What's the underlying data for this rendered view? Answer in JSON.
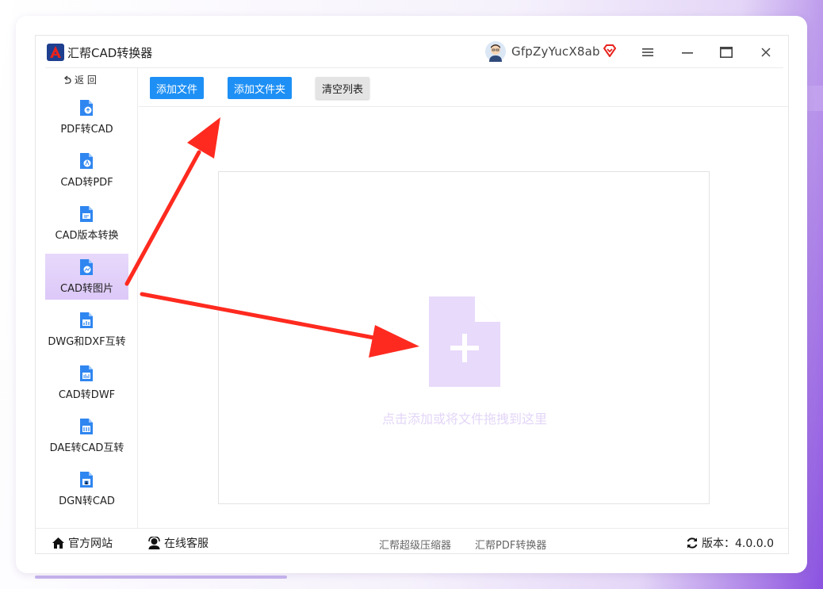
{
  "app": {
    "title": "汇帮CAD转换器",
    "username": "GfpZyYucX8ab"
  },
  "colors": {
    "accent": "#1e90f5",
    "active_nav": "#e2d1fa",
    "drop_icon": "#e8dafb",
    "arrow": "#ff2a1f"
  },
  "sidebar": {
    "back_label": "返 回",
    "items": [
      {
        "label": "PDF转CAD",
        "icon": "pdf-to-cad-icon"
      },
      {
        "label": "CAD转PDF",
        "icon": "cad-to-pdf-icon"
      },
      {
        "label": "CAD版本转换",
        "icon": "cad-version-icon"
      },
      {
        "label": "CAD转图片",
        "icon": "cad-to-image-icon",
        "active": true
      },
      {
        "label": "DWG和DXF互转",
        "icon": "dwg-dxf-icon"
      },
      {
        "label": "CAD转DWF",
        "icon": "cad-to-dwf-icon"
      },
      {
        "label": "DAE转CAD互转",
        "icon": "dae-cad-icon"
      },
      {
        "label": "DGN转CAD",
        "icon": "dgn-cad-icon"
      }
    ]
  },
  "toolbar": {
    "add_file": "添加文件",
    "add_folder": "添加文件夹",
    "clear_list": "清空列表"
  },
  "dropzone": {
    "hint": "点击添加或将文件拖拽到这里"
  },
  "footer": {
    "website": "官方网站",
    "support": "在线客服",
    "link_compressor": "汇帮超级压缩器",
    "link_pdf": "汇帮PDF转换器",
    "version": "版本：4.0.0.0"
  }
}
